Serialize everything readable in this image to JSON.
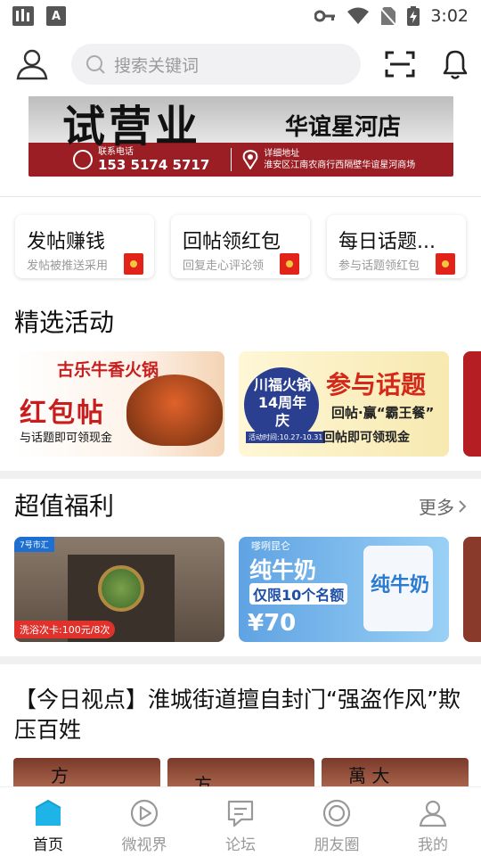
{
  "status": {
    "left_icons": [
      "signal-bars-icon",
      "a-badge-icon"
    ],
    "time": "3:02",
    "a_badge": "A"
  },
  "search": {
    "placeholder": "搜索关键词"
  },
  "banner": {
    "headline": "试营业",
    "store": "华谊星河店",
    "phone_label": "联系电话",
    "phone": "153 5174 5717",
    "address_label": "详细地址",
    "address": "淮安区江南农商行西隔壁华谊星河商场"
  },
  "tasks": [
    {
      "title": "发帖赚钱",
      "subtitle": "发帖被推送采用"
    },
    {
      "title": "回帖领红包",
      "subtitle": "回复走心评论领"
    },
    {
      "title": "每日话题...",
      "subtitle": "参与话题领红包"
    }
  ],
  "sections": {
    "activities": "精选活动",
    "welfare": "超值福利",
    "more": "更多"
  },
  "activity_cards": [
    {
      "brand": "古乐牛香火锅",
      "headline": "红包帖",
      "subtitle": "与话题即可领现金"
    },
    {
      "brand": "川福火锅14周年庆",
      "date": "活动时间:10.27-10.31",
      "headline": "参与话题",
      "line1": "回帖·赢“霸王餐”",
      "line2": "回帖即可领现金"
    }
  ],
  "welfare_cards": [
    {
      "logo": "7号市汇",
      "tag": "洗浴次卡:100元/8次"
    },
    {
      "shop": "嗲咧昆仑",
      "title": "纯牛奶",
      "limit": "仅限10个名额",
      "price": "¥70",
      "bag_text": "纯牛奶"
    }
  ],
  "news": {
    "title": "【今日视点】淮城街道擅自封门“强盗作风”欺压百姓",
    "image_chars": [
      "方",
      "方",
      "萬  大"
    ]
  },
  "tabs": [
    {
      "label": "首页",
      "icon": "home-icon",
      "active": true
    },
    {
      "label": "微视界",
      "icon": "play-circle-icon",
      "active": false
    },
    {
      "label": "论坛",
      "icon": "chat-icon",
      "active": false
    },
    {
      "label": "朋友圈",
      "icon": "friends-circle-icon",
      "active": false
    },
    {
      "label": "我的",
      "icon": "user-icon",
      "active": false
    }
  ],
  "colors": {
    "accent": "#1fb4e8",
    "red": "#c81d1d"
  }
}
